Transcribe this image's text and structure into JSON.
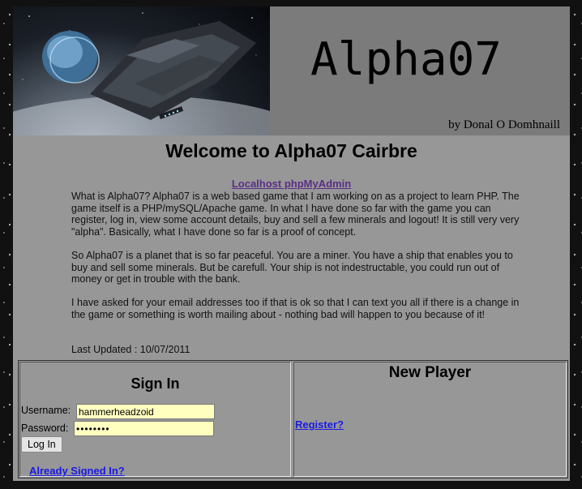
{
  "header": {
    "title": "Alpha07",
    "byline": "by Donal O Domhnaill"
  },
  "main": {
    "heading": "Welcome to Alpha07 Cairbre",
    "phpmyadmin_link": "Localhost phpMyAdmin",
    "paragraphs": [
      "What is Alpha07? Alpha07 is a web based game that I am working on as a project to learn PHP. The game itself is a PHP/mySQL/Apache game. In what I have done so far with the game you can register, log in, view some account details, buy and sell a few minerals and logout! It is still very very \"alpha\". Basically, what I have done so far is a proof of concept.",
      "So Alpha07 is a planet that is so far peaceful. You are a miner. You have a ship that enables you to buy and sell some minerals. But be carefull. Your ship is not indestructable, you could run out of money or get in trouble with the bank.",
      "I have asked for your email addresses too if that is ok so that I can text you all if there is a change in the game or something is worth mailing about - nothing bad will happen to you because of it!"
    ],
    "last_updated": "Last Updated : 10/07/2011"
  },
  "signin": {
    "title": "Sign In",
    "username_label": "Username:",
    "username_value": "hammerheadzoid",
    "password_label": "Password:",
    "password_value": "••••••••",
    "login_button": "Log In",
    "already_signed_in_link": "Already Signed In?"
  },
  "new_player": {
    "title": "New Player",
    "register_link": "Register?"
  }
}
